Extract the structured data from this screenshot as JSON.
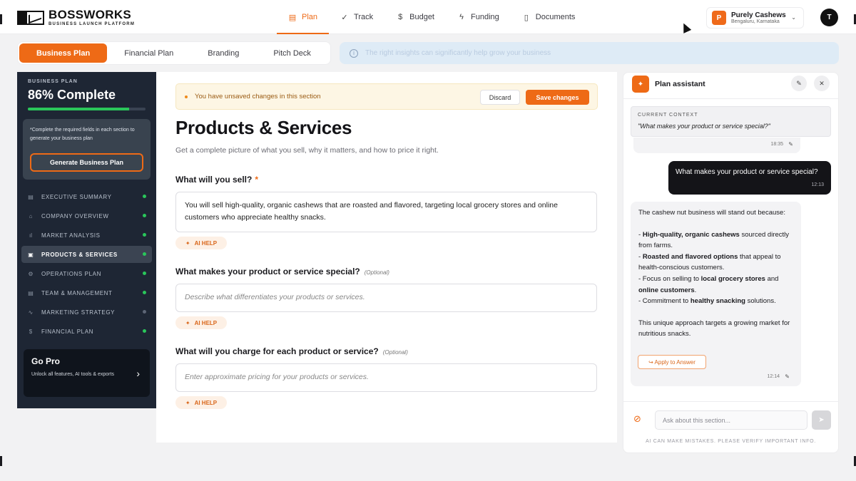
{
  "brand": {
    "name": "BOSSWORKS",
    "tagline": "BUSINESS LAUNCH PLATFORM"
  },
  "nav": {
    "items": [
      {
        "label": "Plan",
        "icon": "document-icon",
        "active": true
      },
      {
        "label": "Track",
        "icon": "check-circle-icon",
        "active": false
      },
      {
        "label": "Budget",
        "icon": "dollar-icon",
        "active": false
      },
      {
        "label": "Funding",
        "icon": "bolt-icon",
        "active": false
      },
      {
        "label": "Documents",
        "icon": "file-icon",
        "active": false
      }
    ]
  },
  "business": {
    "avatar": "P",
    "name": "Purely Cashews",
    "location": "Bengaluru, Karnataka"
  },
  "user": {
    "initial": "T"
  },
  "tabs": [
    {
      "label": "Business Plan",
      "active": true
    },
    {
      "label": "Financial Plan",
      "active": false
    },
    {
      "label": "Branding",
      "active": false
    },
    {
      "label": "Pitch Deck",
      "active": false
    }
  ],
  "banner": {
    "text": "The right insights can significantly help grow your business"
  },
  "sidebar": {
    "label": "BUSINESS PLAN",
    "percent_text": "86% Complete",
    "progress": 0.86,
    "note": "*Complete the required fields in each section to generate your business plan",
    "generate_label": "Generate Business Plan",
    "items": [
      {
        "label": "EXECUTIVE SUMMARY",
        "icon": "document-icon",
        "complete": true,
        "active": false
      },
      {
        "label": "COMPANY OVERVIEW",
        "icon": "building-icon",
        "complete": true,
        "active": false
      },
      {
        "label": "MARKET ANALYSIS",
        "icon": "bar-chart-icon",
        "complete": true,
        "active": false
      },
      {
        "label": "PRODUCTS & SERVICES",
        "icon": "box-icon",
        "complete": true,
        "active": true
      },
      {
        "label": "OPERATIONS PLAN",
        "icon": "gear-icon",
        "complete": true,
        "active": false
      },
      {
        "label": "TEAM & MANAGEMENT",
        "icon": "users-icon",
        "complete": true,
        "active": false
      },
      {
        "label": "MARKETING STRATEGY",
        "icon": "trend-icon",
        "complete": false,
        "active": false
      },
      {
        "label": "FINANCIAL PLAN",
        "icon": "dollar-icon",
        "complete": true,
        "active": false
      }
    ],
    "gopro": {
      "title": "Go Pro",
      "desc": "Unlock all features, AI tools & exports"
    }
  },
  "main": {
    "unsaved_text": "You have unsaved changes in this section",
    "discard_label": "Discard",
    "save_label": "Save changes",
    "title": "Products & Services",
    "subtitle": "Get a complete picture of what you sell, why it matters, and how to price it right.",
    "questions": [
      {
        "label": "What will you sell?",
        "required_mark": "*",
        "optional": "",
        "value": "You will sell high-quality, organic cashews that are roasted and flavored, targeting local grocery stores and online customers who appreciate healthy snacks.",
        "placeholder": ""
      },
      {
        "label": "What makes your product or service special?",
        "required_mark": "",
        "optional": "(Optional)",
        "value": "",
        "placeholder": "Describe what differentiates your products or services."
      },
      {
        "label": "What will you charge for each product or service?",
        "required_mark": "",
        "optional": "(Optional)",
        "value": "",
        "placeholder": "Enter approximate pricing for your products or services."
      }
    ],
    "ai_help_label": "AI HELP"
  },
  "assistant": {
    "title": "Plan assistant",
    "context_label": "CURRENT CONTEXT",
    "context_text": "\"What makes your product or service special?\"",
    "prev_time": "18:35",
    "user_message": "What makes your product or service special?",
    "user_time": "12:13",
    "bot_intro": "The cashew nut business will stand out because:",
    "bot_points": [
      {
        "pre": "- ",
        "b1": "High-quality, organic cashews",
        "mid": " sourced directly from farms.",
        "b2": "",
        "post": ""
      },
      {
        "pre": "- ",
        "b1": "Roasted and flavored options",
        "mid": " that appeal to health-conscious customers.",
        "b2": "",
        "post": ""
      },
      {
        "pre": "- Focus on selling to ",
        "b1": "local grocery stores",
        "mid": " and ",
        "b2": "online customers",
        "post": "."
      },
      {
        "pre": "- Commitment to ",
        "b1": "healthy snacking",
        "mid": " solutions.",
        "b2": "",
        "post": ""
      }
    ],
    "bot_outro": "This unique approach targets a growing market for nutritious snacks.",
    "apply_label": "↪ Apply to Answer",
    "bot_time": "12:14",
    "input_placeholder": "Ask about this section...",
    "disclaimer": "AI CAN MAKE MISTAKES. PLEASE VERIFY IMPORTANT INFO."
  },
  "colors": {
    "accent": "#ee6a16",
    "sidebar_bg": "#1e2634",
    "success": "#2ac65a"
  }
}
